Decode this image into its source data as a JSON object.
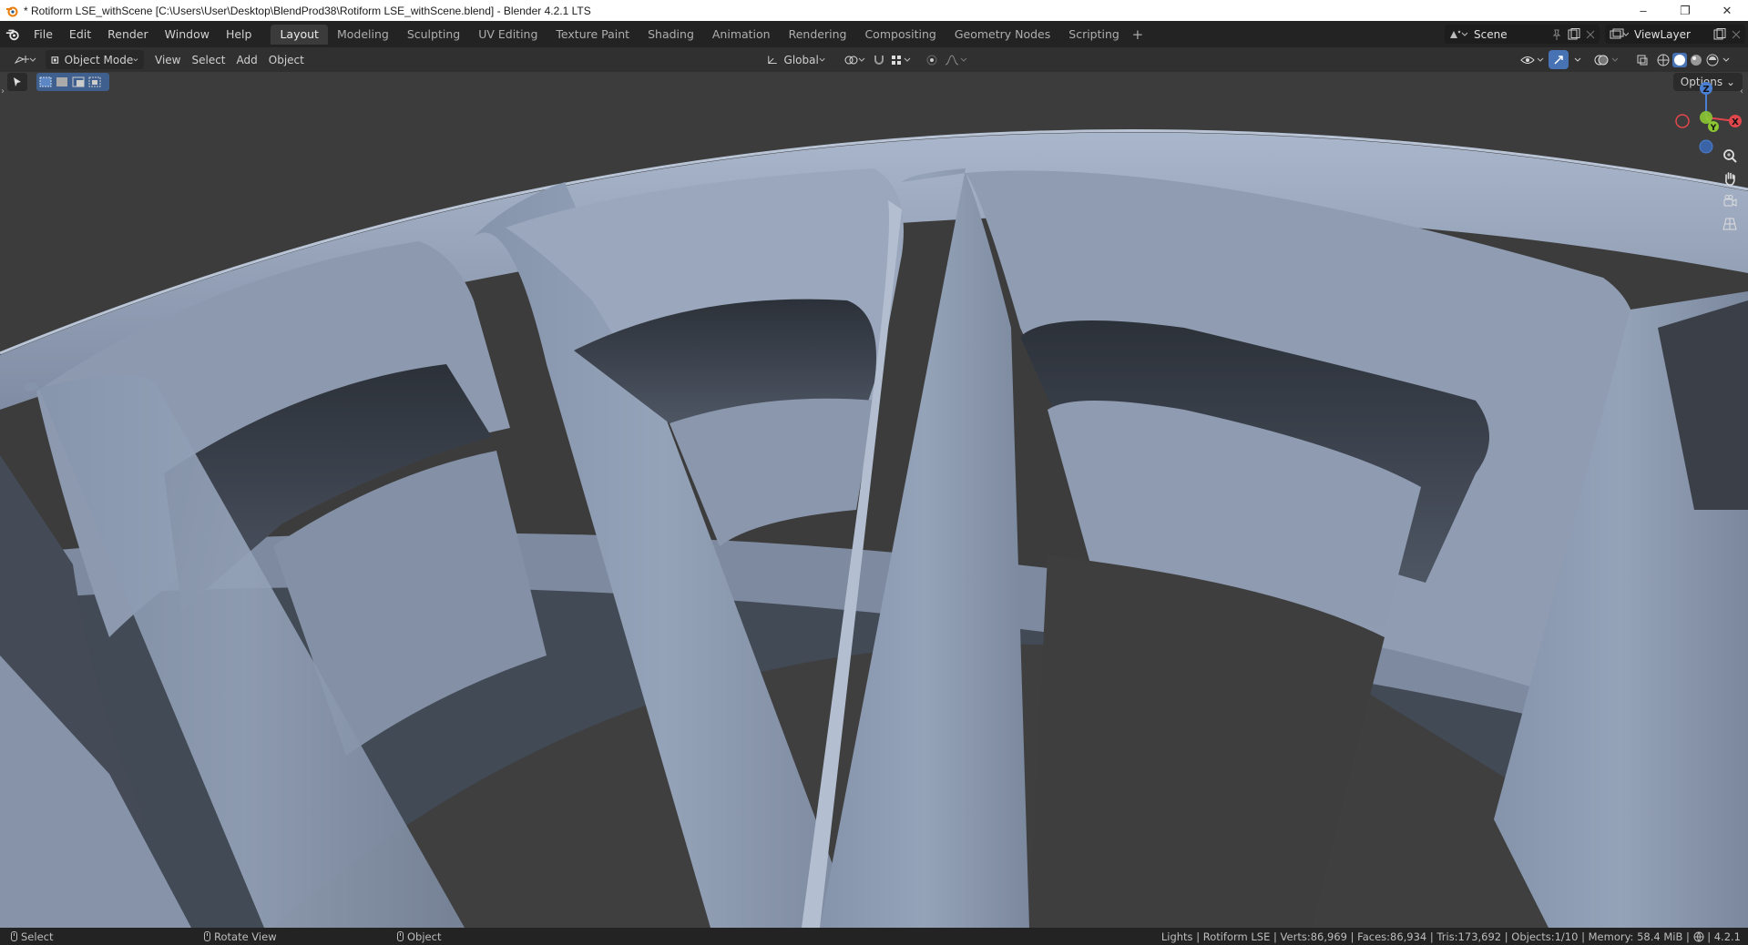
{
  "window": {
    "title": "* Rotiform LSE_withScene [C:\\Users\\User\\Desktop\\BlendProd38\\Rotiform LSE_withScene.blend] - Blender 4.2.1 LTS",
    "minimize": "–",
    "restore": "❐",
    "close": "✕"
  },
  "menu": [
    "File",
    "Edit",
    "Render",
    "Window",
    "Help"
  ],
  "workspaces": [
    {
      "label": "Layout",
      "active": true
    },
    {
      "label": "Modeling"
    },
    {
      "label": "Sculpting"
    },
    {
      "label": "UV Editing"
    },
    {
      "label": "Texture Paint"
    },
    {
      "label": "Shading"
    },
    {
      "label": "Animation"
    },
    {
      "label": "Rendering"
    },
    {
      "label": "Compositing"
    },
    {
      "label": "Geometry Nodes"
    },
    {
      "label": "Scripting"
    }
  ],
  "workspace_add": "+",
  "scene": {
    "label": "Scene"
  },
  "view_layer": {
    "label": "ViewLayer"
  },
  "header": {
    "mode": "Object Mode",
    "view": "View",
    "select": "Select",
    "add": "Add",
    "object": "Object",
    "transform_orientation": "Global"
  },
  "viewport": {
    "options": "Options",
    "gizmo": {
      "z": "Z",
      "x": "X",
      "y": "Y"
    },
    "colors": {
      "background": "#3c3c3c",
      "wheel": "#8e9bb1",
      "wheel_shadow": "#434b58",
      "wheel_dark": "#2f343b"
    }
  },
  "status": {
    "select": "Select",
    "rotate": "Rotate View",
    "object": "Object",
    "stats": "Lights | Rotiform LSE | Verts:86,969 | Faces:86,934 | Tris:173,692 | Objects:1/10 | Memory: 58.4 MiB | ",
    "version": "4.2.1"
  }
}
